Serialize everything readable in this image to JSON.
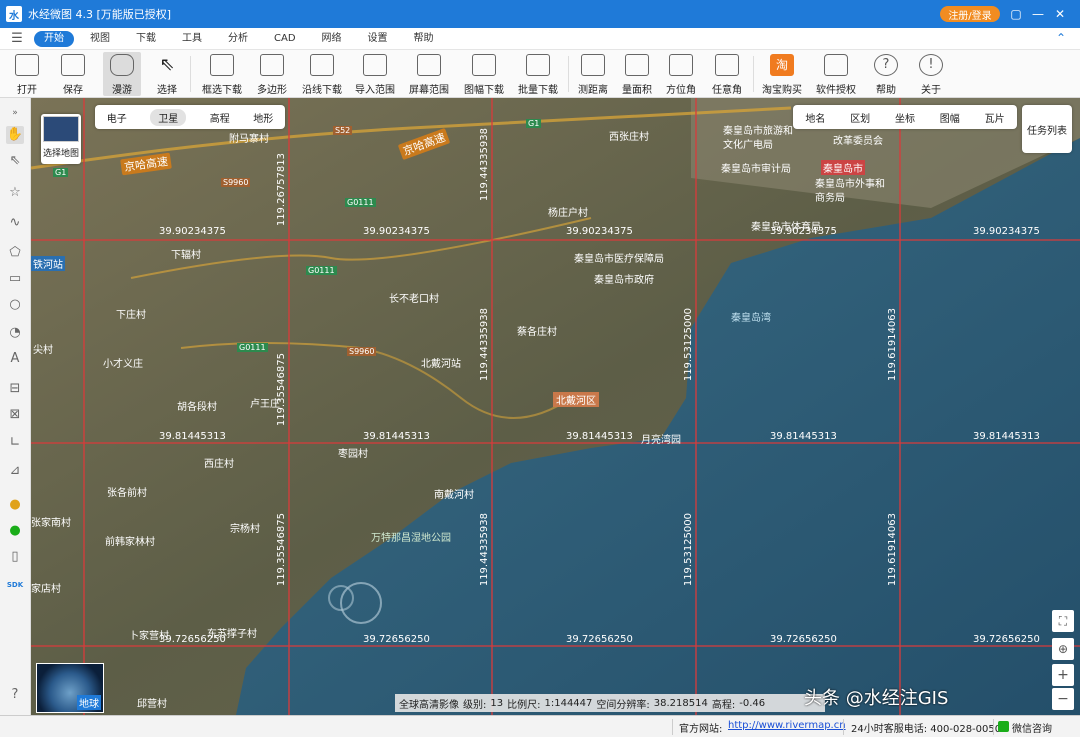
{
  "window": {
    "title": "水经微图 4.3 [万能版已授权]",
    "register_label": "注册/登录"
  },
  "menu": {
    "items": [
      "开始",
      "视图",
      "下载",
      "工具",
      "分析",
      "CAD",
      "网络",
      "设置",
      "帮助"
    ],
    "active_index": 0
  },
  "toolbar": {
    "open": "打开",
    "save": "保存",
    "pan": "漫游",
    "select": "选择",
    "rect_download": "框选下载",
    "polygon": "多边形",
    "line_download": "沿线下载",
    "import_range": "导入范围",
    "screen_range": "屏幕范围",
    "sheet_download": "图幅下载",
    "batch_download": "批量下载",
    "measure_distance": "测距离",
    "measure_area": "量面积",
    "azimuth": "方位角",
    "any_angle": "任意角",
    "taobao": "淘宝购买",
    "license": "软件授权",
    "help": "帮助",
    "about": "关于"
  },
  "map_type": {
    "items": [
      "电子",
      "卫星",
      "高程",
      "地形"
    ],
    "active": "卫星"
  },
  "map_source": {
    "label": "选择地图"
  },
  "layers": {
    "items": [
      "地名",
      "区划",
      "坐标",
      "图幅",
      "瓦片"
    ]
  },
  "task_list": "任务列表",
  "grid": {
    "latitudes": [
      "39.90234375",
      "39.81445313",
      "39.72656250"
    ],
    "longitudes": [
      "119.26757813",
      "119.35546875",
      "119.44335938",
      "119.53125000",
      "119.61914063"
    ]
  },
  "places": [
    "京哈高速",
    "附马寨村",
    "S52",
    "京哈高速",
    "G1",
    "G1",
    "西张庄村",
    "秦皇岛市旅游和文化广电局",
    "改革委员会",
    "秦皇岛市审计局",
    "秦皇岛市",
    "秦皇岛市外事和商务局",
    "S9960",
    "G0111",
    "杨庄户村",
    "秦皇岛市体育局",
    "下辐村",
    "秦皇岛市医疗保障局",
    "秦皇岛市政府",
    "G0111",
    "长不老口村",
    "下庄村",
    "秦皇岛湾",
    "蔡各庄村",
    "G0111",
    "S9960",
    "小才义庄",
    "北戴河站",
    "胡各段村",
    "卢王庄",
    "北戴河区",
    "枣园村",
    "西庄村",
    "张各前村",
    "南戴河村",
    "宗杨村",
    "前韩家林村",
    "万特那昌湿地公园",
    "卜家营村",
    "东苏撑子村",
    "邱营村",
    "铁河站",
    "尖村",
    "张家南村",
    "家店村",
    "月亮湾园"
  ],
  "globe_label": "地球",
  "status": {
    "imagery": "全球高清影像",
    "level_label": "级别:",
    "level": "13",
    "scale_label": "比例尺:",
    "scale": "1:144447",
    "resolution_label": "空间分辨率:",
    "resolution": "38.218514",
    "elevation_label": "高程:",
    "elevation": "-0.46",
    "website_label": "官方网站:",
    "website": "http://www.rivermap.cn",
    "hotline": "24小时客服电话: 400-028-0050",
    "wechat": "微信咨询"
  },
  "watermark": "头条 @水经注GIS",
  "colors": {
    "accent": "#1f7ad8",
    "register": "#f18c21",
    "grid": "#d93b3b",
    "sea": "#2c5f7d",
    "land": "#6a6650"
  }
}
